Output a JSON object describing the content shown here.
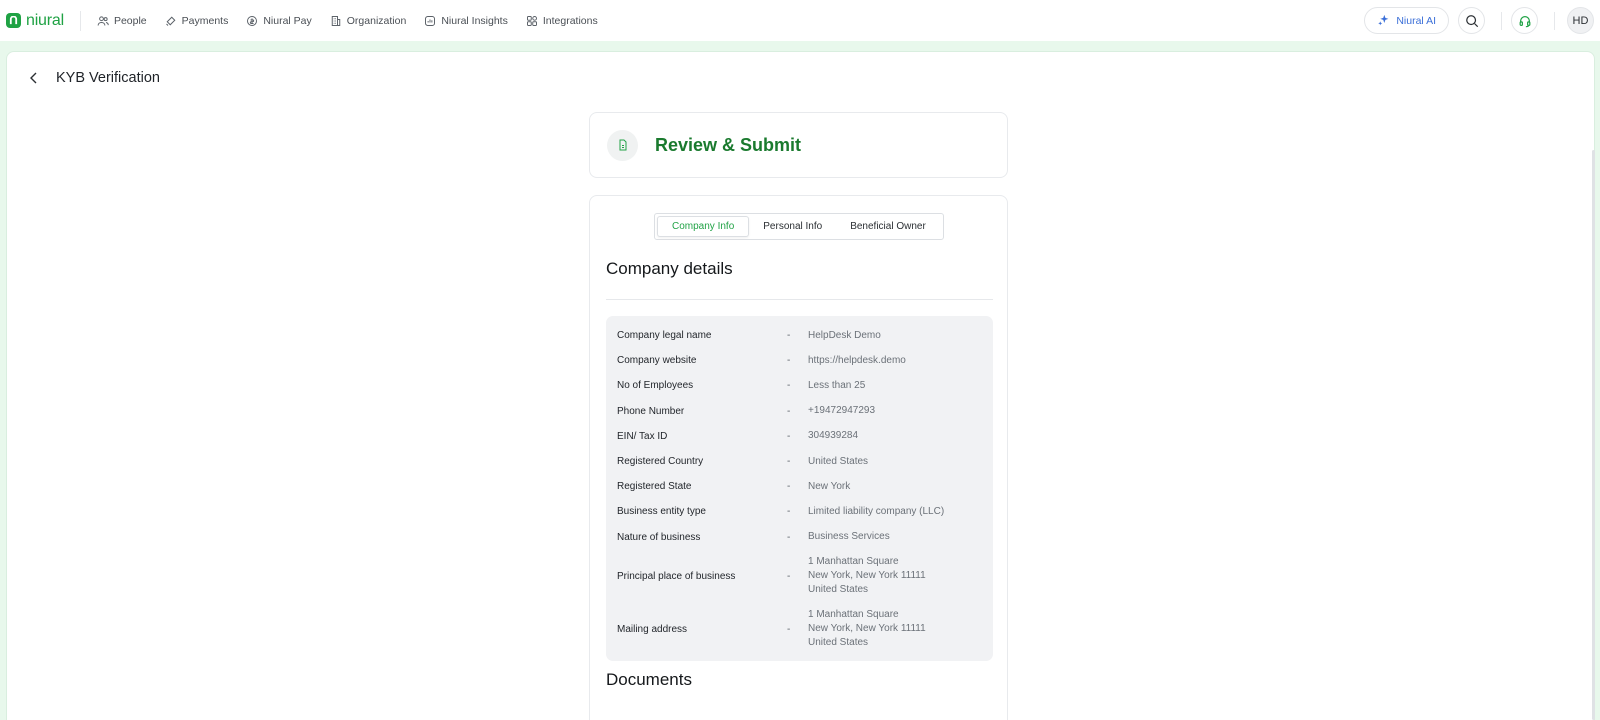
{
  "brand": {
    "name": "niural",
    "color": "#1fa244"
  },
  "nav": {
    "items": [
      {
        "label": "People",
        "icon": "people-icon"
      },
      {
        "label": "Payments",
        "icon": "payments-icon"
      },
      {
        "label": "Niural Pay",
        "icon": "niural-pay-icon"
      },
      {
        "label": "Organization",
        "icon": "organization-icon"
      },
      {
        "label": "Niural Insights",
        "icon": "insights-icon"
      },
      {
        "label": "Integrations",
        "icon": "integrations-icon"
      }
    ],
    "ai_label": "Niural AI",
    "avatar_initials": "HD"
  },
  "page": {
    "title": "KYB Verification"
  },
  "review": {
    "title": "Review & Submit",
    "accent": "#1a7a2e"
  },
  "tabs": [
    {
      "label": "Company Info",
      "active": true
    },
    {
      "label": "Personal Info",
      "active": false
    },
    {
      "label": "Beneficial Owner",
      "active": false
    }
  ],
  "company": {
    "section_title": "Company details",
    "separator": "-",
    "rows": [
      {
        "label": "Company legal name",
        "value": "HelpDesk Demo"
      },
      {
        "label": "Company website",
        "value": "https://helpdesk.demo"
      },
      {
        "label": "No of Employees",
        "value": "Less than 25"
      },
      {
        "label": "Phone Number",
        "value": "+19472947293"
      },
      {
        "label": "EIN/ Tax ID",
        "value": "304939284"
      },
      {
        "label": "Registered Country",
        "value": "United States"
      },
      {
        "label": "Registered State",
        "value": "New York"
      },
      {
        "label": "Business entity type",
        "value": "Limited liability company (LLC)"
      },
      {
        "label": "Nature of business",
        "value": "Business Services"
      },
      {
        "label": "Principal place of business",
        "lines": [
          "1 Manhattan Square",
          "New York, New York 11111",
          "United States"
        ]
      },
      {
        "label": "Mailing address",
        "lines": [
          "1 Manhattan Square",
          "New York, New York 11111",
          "United States"
        ]
      }
    ]
  },
  "documents": {
    "section_title": "Documents"
  }
}
